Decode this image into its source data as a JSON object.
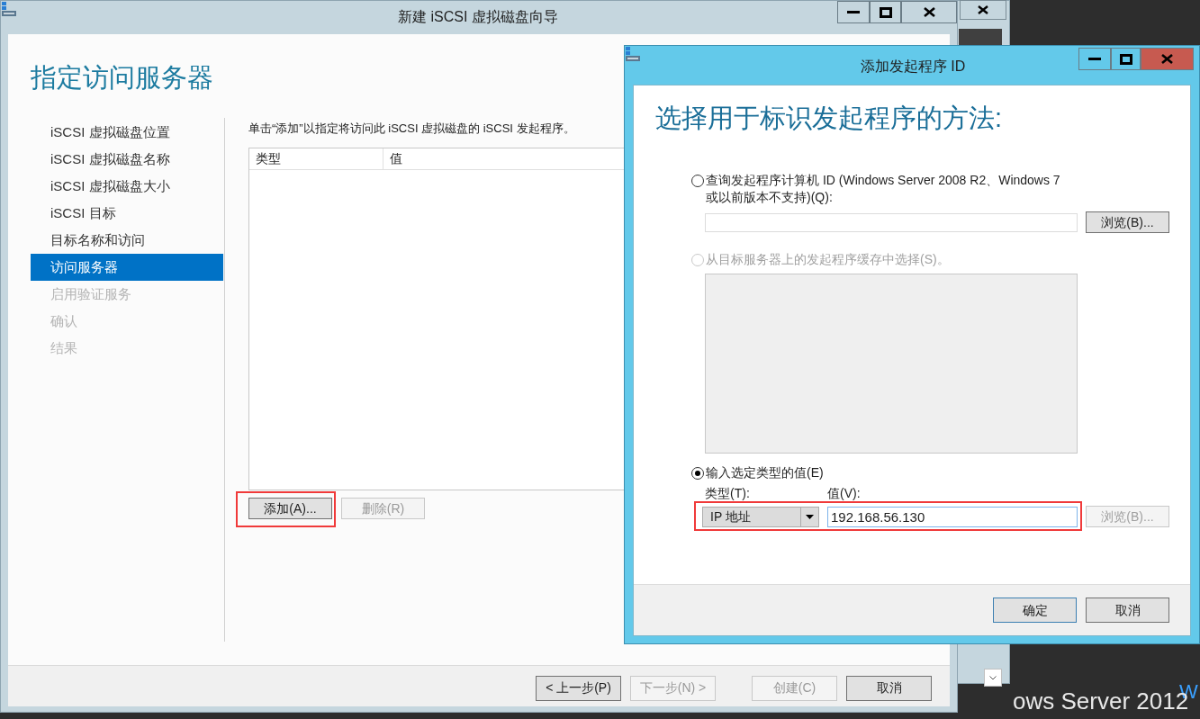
{
  "wizard": {
    "title": "新建 iSCSI 虚拟磁盘向导",
    "heading": "指定访问服务器",
    "steps": [
      {
        "label": "iSCSI 虚拟磁盘位置",
        "selected": false,
        "disabled": false
      },
      {
        "label": "iSCSI 虚拟磁盘名称",
        "selected": false,
        "disabled": false
      },
      {
        "label": "iSCSI 虚拟磁盘大小",
        "selected": false,
        "disabled": false
      },
      {
        "label": "iSCSI 目标",
        "selected": false,
        "disabled": false
      },
      {
        "label": "目标名称和访问",
        "selected": false,
        "disabled": false
      },
      {
        "label": "访问服务器",
        "selected": true,
        "disabled": false
      },
      {
        "label": "启用验证服务",
        "selected": false,
        "disabled": true
      },
      {
        "label": "确认",
        "selected": false,
        "disabled": true
      },
      {
        "label": "结果",
        "selected": false,
        "disabled": true
      }
    ],
    "description": "单击“添加”以指定将访问此 iSCSI 虚拟磁盘的 iSCSI 发起程序。",
    "table": {
      "columns": [
        "类型",
        "值"
      ]
    },
    "buttons": [
      {
        "label": "添加(A)...",
        "disabled": false,
        "highlighted": true
      },
      {
        "label": "删除(R)",
        "disabled": true,
        "highlighted": false
      }
    ],
    "footer_buttons": [
      {
        "label": "< 上一步(P)",
        "disabled": false
      },
      {
        "label": "下一步(N) >",
        "disabled": true
      },
      {
        "label": "创建(C)",
        "disabled": true
      },
      {
        "label": "取消",
        "disabled": false
      }
    ]
  },
  "dialog": {
    "title": "添加发起程序 ID",
    "heading": "选择用于标识发起程序的方法:",
    "options": [
      {
        "kind": "field",
        "label": "查询发起程序计算机 ID (Windows Server 2008 R2、Windows 7 或以前版本不支持)(Q):",
        "selected": false,
        "disabled": false,
        "browse": {
          "label": "浏览(B)...",
          "disabled": false
        }
      },
      {
        "kind": "list",
        "label": "从目标服务器上的发起程序缓存中选择(S)。",
        "selected": false,
        "disabled": true
      },
      {
        "kind": "typed",
        "label": "输入选定类型的值(E)",
        "selected": true,
        "disabled": false,
        "type_label": "类型(T):",
        "value_label": "值(V):",
        "type_value": "IP 地址",
        "value": "192.168.56.130",
        "highlighted": true,
        "browse": {
          "label": "浏览(B)...",
          "disabled": true
        }
      }
    ],
    "buttons": [
      {
        "label": "确定",
        "focused": true
      },
      {
        "label": "取消",
        "focused": false
      }
    ]
  },
  "desktop": {
    "texts": [
      "W",
      "ows Server 2012"
    ]
  }
}
